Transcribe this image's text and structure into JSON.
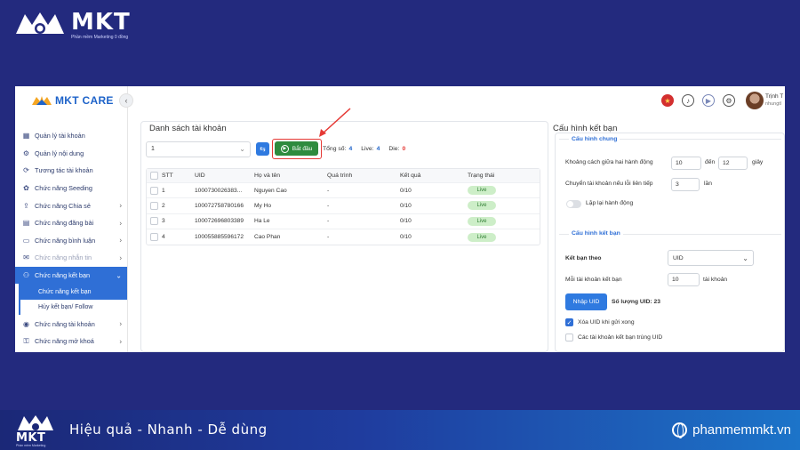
{
  "brand": {
    "name": "MKT",
    "tagline": "Phần mềm Marketing 0 đồng"
  },
  "app": {
    "logo_text": "MKT CARE",
    "collapse_icon": "chevron-left-icon"
  },
  "header": {
    "user_name": "Trịnh T",
    "user_email": "nhungtl"
  },
  "sidebar": {
    "items": [
      {
        "label": "Quản lý tài khoản",
        "icon": "grid-icon",
        "chevron": false
      },
      {
        "label": "Quản lý nội dung",
        "icon": "gear-icon",
        "chevron": false
      },
      {
        "label": "Tương tác tài khoản",
        "icon": "refresh-icon",
        "chevron": false
      },
      {
        "label": "Chức năng Seeding",
        "icon": "seed-icon",
        "chevron": false
      },
      {
        "label": "Chức năng Chia sẻ",
        "icon": "share-icon",
        "chevron": true
      },
      {
        "label": "Chức năng đăng bài",
        "icon": "post-icon",
        "chevron": true
      },
      {
        "label": "Chức năng bình luận",
        "icon": "comment-icon",
        "chevron": true
      },
      {
        "label": "Chức năng nhắn tin",
        "icon": "message-icon",
        "chevron": true
      },
      {
        "label": "Chức năng kết bạn",
        "icon": "add-friend-icon",
        "chevron": true
      }
    ],
    "submenu": [
      {
        "label": "Chức năng kết bạn"
      },
      {
        "label": "Hủy kết bạn/ Follow"
      }
    ],
    "items_after": [
      {
        "label": "Chức năng tài khoản",
        "icon": "account-icon",
        "chevron": true
      },
      {
        "label": "Chức năng mở khoá",
        "icon": "unlock-icon",
        "chevron": true
      }
    ]
  },
  "accounts_panel": {
    "title": "Danh sách tài khoản",
    "select_value": "1",
    "start_label": "Bắt đầu",
    "total_label": "Tổng số:",
    "total_value": "4",
    "live_label": "Live:",
    "live_value": "4",
    "die_label": "Die:",
    "die_value": "0",
    "columns": [
      "STT",
      "UID",
      "Họ và tên",
      "Quá trình",
      "Kết quả",
      "Trạng thái"
    ],
    "rows": [
      {
        "stt": "1",
        "uid": "1000730026383...",
        "name": "Nguyen Cao",
        "progress": "-",
        "result": "0/10",
        "status": "Live"
      },
      {
        "stt": "2",
        "uid": "100072758780166",
        "name": "My Ho",
        "progress": "-",
        "result": "0/10",
        "status": "Live"
      },
      {
        "stt": "3",
        "uid": "100072696803389",
        "name": "Ha Le",
        "progress": "-",
        "result": "0/10",
        "status": "Live"
      },
      {
        "stt": "4",
        "uid": "100055885596172",
        "name": "Cao Phan",
        "progress": "-",
        "result": "0/10",
        "status": "Live"
      }
    ]
  },
  "config_panel": {
    "title": "Cấu hình kết bạn",
    "general_section": "Cấu hình chung",
    "delay_label": "Khoảng cách giữa hai hành động",
    "delay_from": "10",
    "delay_to_label": "đến",
    "delay_to": "12",
    "delay_unit": "giây",
    "switch_label": "Chuyển tài khoản nếu lỗi liên tiếp",
    "switch_value": "3",
    "switch_unit": "lần",
    "repeat_label": "Lặp lại hành động",
    "friend_section": "Cấu hình kết bạn",
    "by_label": "Kết bạn theo",
    "by_value": "UID",
    "per_account_label": "Mỗi tài khoản kết bạn",
    "per_account_value": "10",
    "per_account_unit": "tài khoản",
    "import_button": "Nhập UID",
    "uid_count": "Số lượng UID: 23",
    "delete_uid_label": "Xóa UID khi gửi xong",
    "delete_uid_checked": true,
    "dup_label": "Các tài khoản kết bạn trùng UID",
    "dup_checked": false
  },
  "footer": {
    "brand": "MKT",
    "tagline": "Phần mềm Marketing",
    "slogan": "Hiệu quả - Nhanh  - Dễ dùng",
    "site": "phanmemmkt.vn"
  },
  "colors": {
    "background": "#232a7e",
    "accent": "#2f6fd6",
    "start": "#2e8b3e",
    "highlight": "#e53935"
  }
}
